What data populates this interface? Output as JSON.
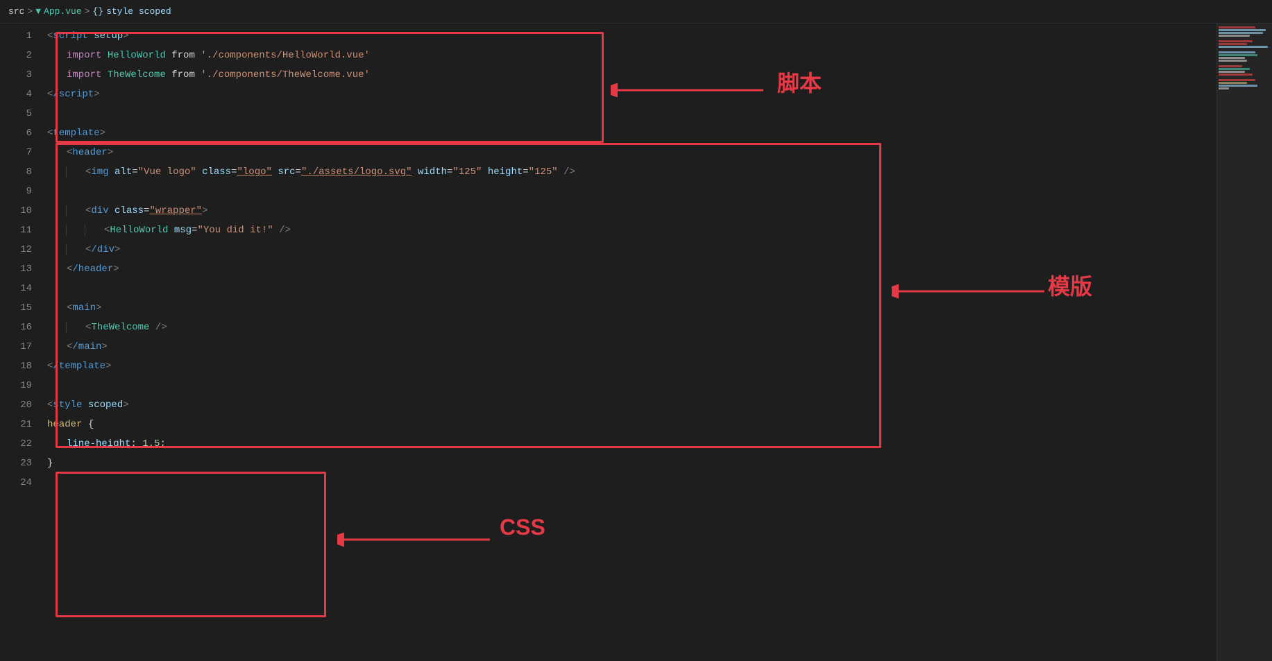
{
  "breadcrumb": {
    "src": "src",
    "sep1": ">",
    "vue_icon": "V",
    "app_vue": "App.vue",
    "sep2": ">",
    "braces": "{}",
    "style_scoped": "style scoped"
  },
  "annotations": {
    "script_label": "脚本",
    "template_label": "模版",
    "css_label": "CSS"
  },
  "lines": [
    {
      "num": 1,
      "indent": 0,
      "tokens": [
        {
          "t": "<",
          "c": "c-angle"
        },
        {
          "t": "script",
          "c": "c-keyword"
        },
        {
          "t": " ",
          "c": "c-white"
        },
        {
          "t": "setup",
          "c": "c-attr"
        },
        {
          "t": ">",
          "c": "c-angle"
        }
      ]
    },
    {
      "num": 2,
      "indent": 1,
      "tokens": [
        {
          "t": "import",
          "c": "c-import"
        },
        {
          "t": " ",
          "c": "c-white"
        },
        {
          "t": "HelloWorld",
          "c": "c-component"
        },
        {
          "t": " ",
          "c": "c-white"
        },
        {
          "t": "from",
          "c": "c-from"
        },
        {
          "t": " ",
          "c": "c-white"
        },
        {
          "t": "'./components/HelloWorld.vue'",
          "c": "c-string"
        }
      ]
    },
    {
      "num": 3,
      "indent": 1,
      "tokens": [
        {
          "t": "import",
          "c": "c-import"
        },
        {
          "t": " ",
          "c": "c-white"
        },
        {
          "t": "TheWelcome",
          "c": "c-component"
        },
        {
          "t": " ",
          "c": "c-white"
        },
        {
          "t": "from",
          "c": "c-from"
        },
        {
          "t": " ",
          "c": "c-white"
        },
        {
          "t": "'./components/TheWelcome.vue'",
          "c": "c-string"
        }
      ]
    },
    {
      "num": 4,
      "indent": 0,
      "tokens": [
        {
          "t": "<",
          "c": "c-angle"
        },
        {
          "t": "/script",
          "c": "c-keyword"
        },
        {
          "t": ">",
          "c": "c-angle"
        }
      ]
    },
    {
      "num": 5,
      "indent": 0,
      "tokens": []
    },
    {
      "num": 6,
      "indent": 0,
      "tokens": [
        {
          "t": "<",
          "c": "c-angle"
        },
        {
          "t": "template",
          "c": "c-keyword"
        },
        {
          "t": ">",
          "c": "c-angle"
        }
      ]
    },
    {
      "num": 7,
      "indent": 1,
      "tokens": [
        {
          "t": "<",
          "c": "c-angle"
        },
        {
          "t": "header",
          "c": "c-keyword"
        },
        {
          "t": ">",
          "c": "c-angle"
        }
      ]
    },
    {
      "num": 8,
      "indent": 2,
      "tokens": [
        {
          "t": "<",
          "c": "c-angle"
        },
        {
          "t": "img",
          "c": "c-keyword"
        },
        {
          "t": " ",
          "c": "c-white"
        },
        {
          "t": "alt",
          "c": "c-attr"
        },
        {
          "t": "=",
          "c": "c-white"
        },
        {
          "t": "\"Vue logo\"",
          "c": "c-attr-val"
        },
        {
          "t": " ",
          "c": "c-white"
        },
        {
          "t": "class",
          "c": "c-attr"
        },
        {
          "t": "=",
          "c": "c-white"
        },
        {
          "t": "\"logo\"",
          "c": "c-underline"
        },
        {
          "t": " ",
          "c": "c-white"
        },
        {
          "t": "src",
          "c": "c-attr"
        },
        {
          "t": "=",
          "c": "c-white"
        },
        {
          "t": "\"./assets/logo.svg\"",
          "c": "c-underline"
        },
        {
          "t": " ",
          "c": "c-white"
        },
        {
          "t": "width",
          "c": "c-attr"
        },
        {
          "t": "=",
          "c": "c-white"
        },
        {
          "t": "\"125\"",
          "c": "c-attr-val"
        },
        {
          "t": " ",
          "c": "c-white"
        },
        {
          "t": "height",
          "c": "c-attr"
        },
        {
          "t": "=",
          "c": "c-white"
        },
        {
          "t": "\"125\"",
          "c": "c-attr-val"
        },
        {
          "t": " />",
          "c": "c-angle"
        }
      ]
    },
    {
      "num": 9,
      "indent": 0,
      "tokens": []
    },
    {
      "num": 10,
      "indent": 2,
      "tokens": [
        {
          "t": "<",
          "c": "c-angle"
        },
        {
          "t": "div",
          "c": "c-keyword"
        },
        {
          "t": " ",
          "c": "c-white"
        },
        {
          "t": "class",
          "c": "c-attr"
        },
        {
          "t": "=",
          "c": "c-white"
        },
        {
          "t": "\"wrapper\"",
          "c": "c-underline"
        },
        {
          "t": ">",
          "c": "c-angle"
        }
      ]
    },
    {
      "num": 11,
      "indent": 3,
      "tokens": [
        {
          "t": "<",
          "c": "c-angle"
        },
        {
          "t": "HelloWorld",
          "c": "c-component"
        },
        {
          "t": " ",
          "c": "c-white"
        },
        {
          "t": "msg",
          "c": "c-prop"
        },
        {
          "t": "=",
          "c": "c-white"
        },
        {
          "t": "\"You did it!\"",
          "c": "c-prop-val"
        },
        {
          "t": " />",
          "c": "c-angle"
        }
      ]
    },
    {
      "num": 12,
      "indent": 2,
      "tokens": [
        {
          "t": "<",
          "c": "c-angle"
        },
        {
          "t": "/div",
          "c": "c-keyword"
        },
        {
          "t": ">",
          "c": "c-angle"
        }
      ]
    },
    {
      "num": 13,
      "indent": 1,
      "tokens": [
        {
          "t": "<",
          "c": "c-angle"
        },
        {
          "t": "/header",
          "c": "c-keyword"
        },
        {
          "t": ">",
          "c": "c-angle"
        }
      ]
    },
    {
      "num": 14,
      "indent": 0,
      "tokens": []
    },
    {
      "num": 15,
      "indent": 1,
      "tokens": [
        {
          "t": "<",
          "c": "c-angle"
        },
        {
          "t": "main",
          "c": "c-keyword"
        },
        {
          "t": ">",
          "c": "c-angle"
        }
      ]
    },
    {
      "num": 16,
      "indent": 2,
      "tokens": [
        {
          "t": "<",
          "c": "c-angle"
        },
        {
          "t": "TheWelcome",
          "c": "c-component"
        },
        {
          "t": " />",
          "c": "c-angle"
        }
      ]
    },
    {
      "num": 17,
      "indent": 1,
      "tokens": [
        {
          "t": "<",
          "c": "c-angle"
        },
        {
          "t": "/main",
          "c": "c-keyword"
        },
        {
          "t": ">",
          "c": "c-angle"
        }
      ]
    },
    {
      "num": 18,
      "indent": 0,
      "tokens": [
        {
          "t": "<",
          "c": "c-angle"
        },
        {
          "t": "/template",
          "c": "c-keyword"
        },
        {
          "t": ">",
          "c": "c-angle"
        }
      ]
    },
    {
      "num": 19,
      "indent": 0,
      "tokens": []
    },
    {
      "num": 20,
      "indent": 0,
      "tokens": [
        {
          "t": "<",
          "c": "c-angle"
        },
        {
          "t": "style",
          "c": "c-keyword"
        },
        {
          "t": " ",
          "c": "c-white"
        },
        {
          "t": "scoped",
          "c": "c-attr"
        },
        {
          "t": ">",
          "c": "c-angle"
        }
      ]
    },
    {
      "num": 21,
      "indent": 0,
      "tokens": [
        {
          "t": "header ",
          "c": "c-css-sel"
        },
        {
          "t": "{",
          "c": "c-white"
        }
      ]
    },
    {
      "num": 22,
      "indent": 1,
      "tokens": [
        {
          "t": "line-height",
          "c": "c-css-prop"
        },
        {
          "t": ": ",
          "c": "c-white"
        },
        {
          "t": "1.5",
          "c": "c-css-val"
        },
        {
          "t": ";",
          "c": "c-white"
        }
      ]
    },
    {
      "num": 23,
      "indent": 0,
      "tokens": [
        {
          "t": "}",
          "c": "c-white"
        }
      ]
    },
    {
      "num": 24,
      "indent": 0,
      "tokens": []
    }
  ]
}
